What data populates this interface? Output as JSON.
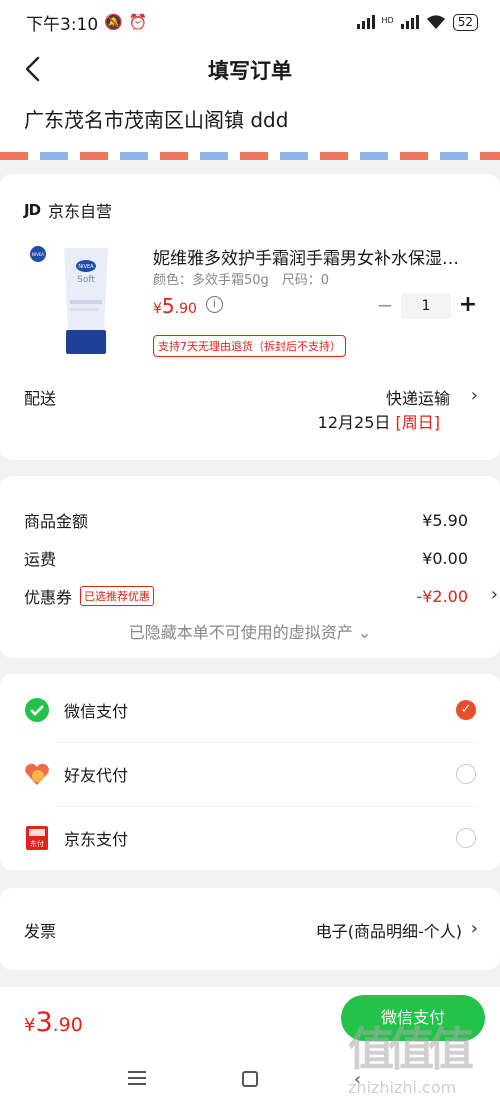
{
  "status_bar": {
    "time": "下午3:10",
    "battery": "52",
    "net_label": "HD"
  },
  "header": {
    "title": "填写订单"
  },
  "address": {
    "text": "广东茂名市茂南区山阁镇 ddd"
  },
  "shop": {
    "logo_text": "JD",
    "name": "京东自营"
  },
  "product": {
    "name": "妮维雅多效护手霜润手霜男女补水保湿擦...",
    "spec": "颜色：多效手霜50g　尺码：0",
    "price_currency": "¥",
    "price_int": "5",
    "price_dec": ".90",
    "quantity": "1",
    "minus": "−",
    "plus": "+",
    "return_policy": "支持7天无理由退货（拆封后不支持）",
    "image_brand": "NIVEA",
    "image_text": "Soft"
  },
  "delivery": {
    "label": "配送",
    "method": "快递运输",
    "date": "12月25日",
    "weekday": "[周日]"
  },
  "summary": {
    "goods_label": "商品金额",
    "goods_value": "¥5.90",
    "shipping_label": "运费",
    "shipping_value": "¥0.00",
    "coupon_label": "优惠券",
    "coupon_badge": "已选推荐优惠",
    "coupon_value": "-¥2.00",
    "hidden_assets": "已隐藏本单不可使用的虚拟资产 ⌄"
  },
  "payment": {
    "options": [
      {
        "label": "微信支付",
        "selected": true
      },
      {
        "label": "好友代付",
        "selected": false
      },
      {
        "label": "京东支付",
        "selected": false
      }
    ],
    "jd_icon_text": "东付"
  },
  "invoice": {
    "label": "发票",
    "value": "电子(商品明细-个人)"
  },
  "bottom": {
    "total_currency": "¥",
    "total_int": "3",
    "total_dec": ".90",
    "pay_button": "微信支付"
  },
  "watermark": {
    "logo": "值值值",
    "text": "zhizhizhi.com"
  },
  "colors": {
    "accent": "#e2231a",
    "wechat_green": "#23c34a",
    "radio_on": "#e94d2c"
  }
}
